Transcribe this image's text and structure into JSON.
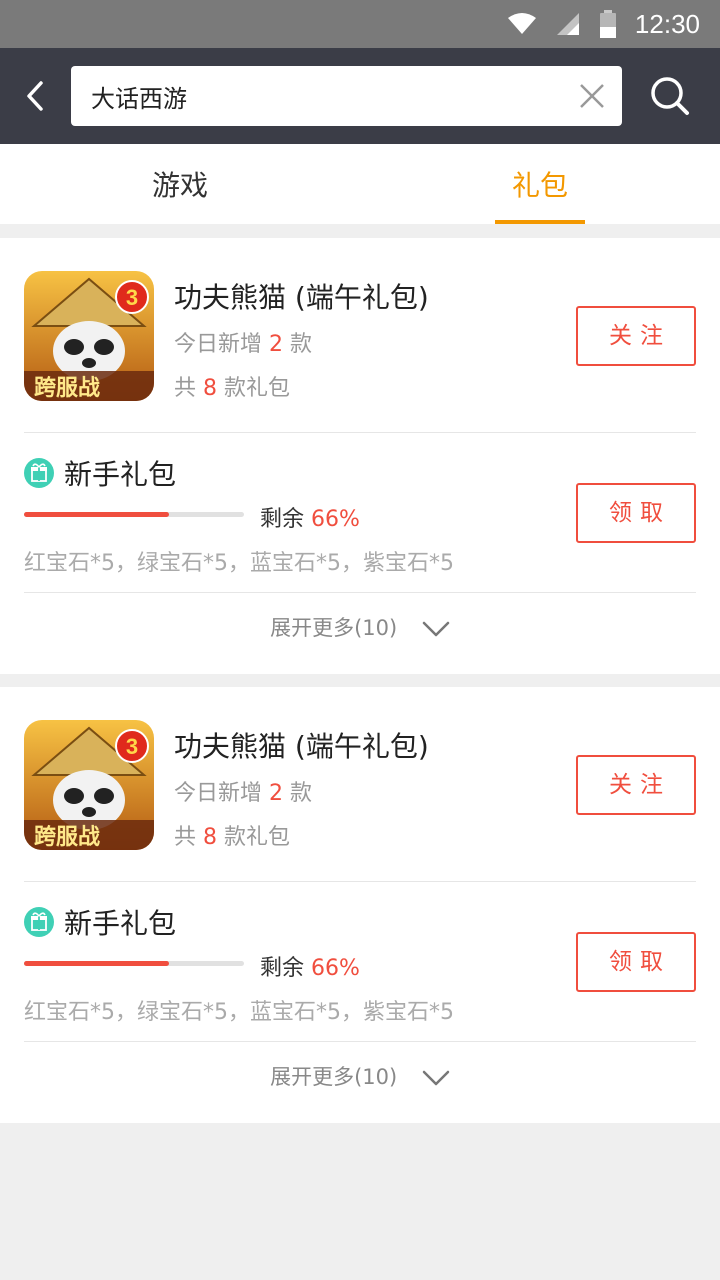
{
  "status_bar": {
    "time": "12:30",
    "icons": [
      "wifi-icon",
      "signal-icon",
      "battery-icon"
    ]
  },
  "search": {
    "query": "大话西游",
    "back_icon": "back-arrow-icon",
    "clear_icon": "close-icon",
    "search_icon": "search-icon"
  },
  "tabs": [
    {
      "label": "游戏",
      "active": false
    },
    {
      "label": "礼包",
      "active": true
    }
  ],
  "colors": {
    "accent": "#f39800",
    "red": "#f04e3e",
    "header_bg": "#3b3d47",
    "gift_icon": "#3fd0b5"
  },
  "cards": [
    {
      "game_title": "功夫熊猫 (端午礼包)",
      "today_new_prefix": "今日新增",
      "today_new_count": "2",
      "today_new_suffix": "款",
      "total_prefix": "共",
      "total_count": "8",
      "total_suffix": "款礼包",
      "follow_label": "关注",
      "icon_badge": "跨服战",
      "icon_number": "3",
      "gift": {
        "name": "新手礼包",
        "remain_label": "剩余",
        "remain_value": "66%",
        "remain_fraction": 0.66,
        "contents": "红宝石*5，绿宝石*5，蓝宝石*5，紫宝石*5",
        "claim_label": "领取"
      },
      "expand_label": "展开更多(10)"
    },
    {
      "game_title": "功夫熊猫 (端午礼包)",
      "today_new_prefix": "今日新增",
      "today_new_count": "2",
      "today_new_suffix": "款",
      "total_prefix": "共",
      "total_count": "8",
      "total_suffix": "款礼包",
      "follow_label": "关注",
      "icon_badge": "跨服战",
      "icon_number": "3",
      "gift": {
        "name": "新手礼包",
        "remain_label": "剩余",
        "remain_value": "66%",
        "remain_fraction": 0.66,
        "contents": "红宝石*5，绿宝石*5，蓝宝石*5，紫宝石*5",
        "claim_label": "领取"
      },
      "expand_label": "展开更多(10)"
    }
  ]
}
